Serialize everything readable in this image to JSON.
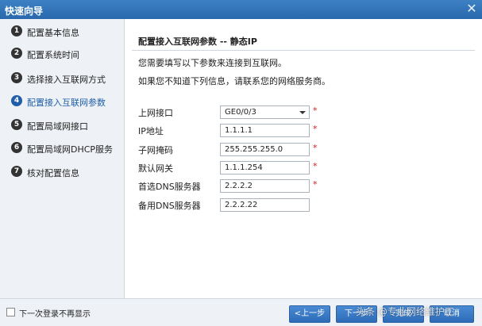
{
  "window": {
    "title": "快速向导",
    "close_glyph": "✕"
  },
  "steps": [
    {
      "num": "1",
      "label": "配置基本信息",
      "active": false
    },
    {
      "num": "2",
      "label": "配置系统时间",
      "active": false
    },
    {
      "num": "3",
      "label": "选择接入互联网方式",
      "active": false
    },
    {
      "num": "4",
      "label": "配置接入互联网参数",
      "active": true
    },
    {
      "num": "5",
      "label": "配置局域网接口",
      "active": false
    },
    {
      "num": "6",
      "label": "配置局域网DHCP服务",
      "active": false
    },
    {
      "num": "7",
      "label": "核对配置信息",
      "active": false
    }
  ],
  "main": {
    "title": "配置接入互联网参数 -- 静态IP",
    "info1": "您需要填写以下参数来连接到互联网。",
    "info2": "如果您不知道下列信息，请联系您的网络服务商。"
  },
  "fields": {
    "uplink": {
      "label": "上网接口",
      "value": "GE0/0/3",
      "required": "*"
    },
    "ip": {
      "label": "IP地址",
      "value": "1.1.1.1",
      "required": "*"
    },
    "mask": {
      "label": "子网掩码",
      "value": "255.255.255.0",
      "required": "*"
    },
    "gateway": {
      "label": "默认网关",
      "value": "1.1.1.254",
      "required": "*"
    },
    "dns1": {
      "label": "首选DNS服务器",
      "value": "2.2.2.2",
      "required": "*"
    },
    "dns2": {
      "label": "备用DNS服务器",
      "value": "2.2.2.22"
    }
  },
  "footer": {
    "checkbox_label": "下一次登录不再显示",
    "prev": "<上一步",
    "next": "下一步",
    "finish": "完成",
    "cancel": "取消"
  },
  "watermark": "头条 @专业网络维护工"
}
